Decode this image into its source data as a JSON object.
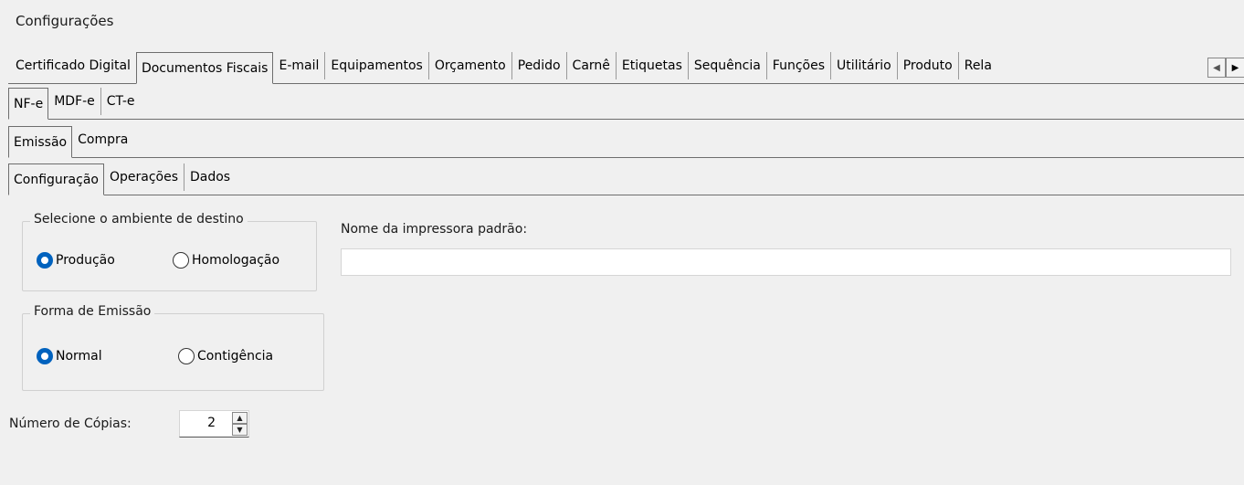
{
  "window": {
    "title": "Configurações"
  },
  "tabs_level1": {
    "items": [
      "Certificado Digital",
      "Documentos Fiscais",
      "E-mail",
      "Equipamentos",
      "Orçamento",
      "Pedido",
      "Carnê",
      "Etiquetas",
      "Sequência",
      "Funções",
      "Utilitário",
      "Produto",
      "Rela"
    ],
    "active": "Documentos Fiscais"
  },
  "tabs_level2": {
    "items": [
      "NF-e",
      "MDF-e",
      "CT-e"
    ],
    "active": "NF-e"
  },
  "tabs_level3": {
    "items": [
      "Emissão",
      "Compra"
    ],
    "active": "Emissão"
  },
  "tabs_level4": {
    "items": [
      "Configuração",
      "Operações",
      "Dados"
    ],
    "active": "Configuração"
  },
  "ambiente": {
    "legend": "Selecione o ambiente de destino",
    "options": [
      "Produção",
      "Homologação"
    ],
    "selected": "Produção"
  },
  "forma_emissao": {
    "legend": "Forma de Emissão",
    "options": [
      "Normal",
      "Contigência"
    ],
    "selected": "Normal"
  },
  "impressora": {
    "label": "Nome da impressora padrão:",
    "value": ""
  },
  "copias": {
    "label": "Número de Cópias:",
    "value": "2"
  },
  "icons": {
    "scroll_left": "triangle-left-icon",
    "scroll_right": "triangle-right-icon",
    "spin_up": "up-arrow-icon",
    "spin_down": "down-arrow-icon"
  },
  "colors": {
    "radio_checked": "#0062be",
    "background": "#f0f0f0"
  }
}
